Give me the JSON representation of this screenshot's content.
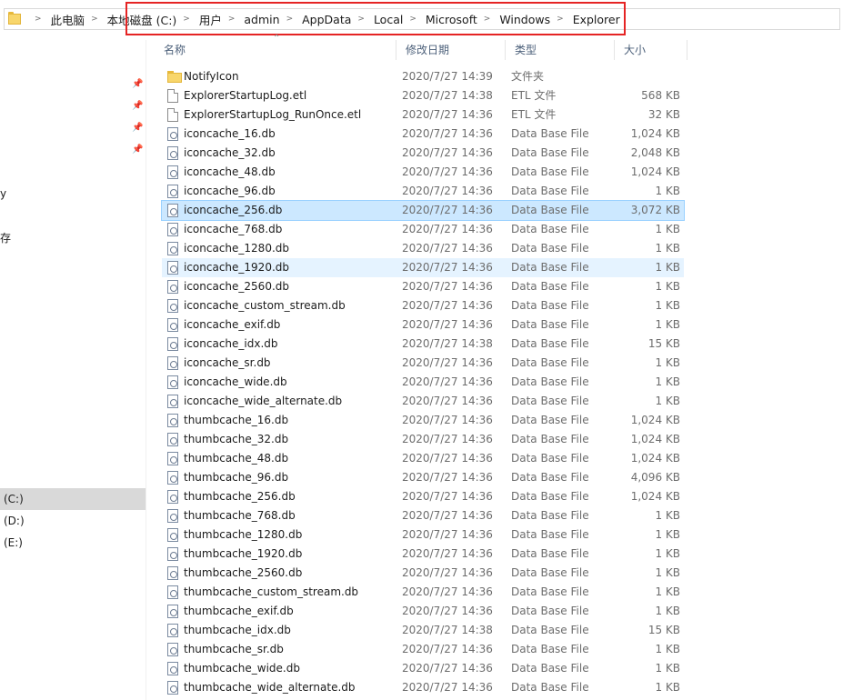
{
  "address": {
    "crumbs": [
      "此电脑",
      "本地磁盘 (C:)",
      "用户",
      "admin",
      "AppData",
      "Local",
      "Microsoft",
      "Windows",
      "Explorer"
    ]
  },
  "nav": {
    "fragment1": "y",
    "fragment2": "存",
    "drives": [
      "(C:)",
      "(D:)",
      "(E:)"
    ]
  },
  "columns": {
    "name": "名称",
    "date": "修改日期",
    "type": "类型",
    "size": "大小"
  },
  "files": [
    {
      "name": "NotifyIcon",
      "date": "2020/7/27 14:39",
      "type": "文件夹",
      "size": "",
      "icon": "folder-icon"
    },
    {
      "name": "ExplorerStartupLog.etl",
      "date": "2020/7/27 14:38",
      "type": "ETL 文件",
      "size": "568 KB",
      "icon": "file-icon"
    },
    {
      "name": "ExplorerStartupLog_RunOnce.etl",
      "date": "2020/7/27 14:36",
      "type": "ETL 文件",
      "size": "32 KB",
      "icon": "file-icon"
    },
    {
      "name": "iconcache_16.db",
      "date": "2020/7/27 14:36",
      "type": "Data Base File",
      "size": "1,024 KB",
      "icon": "database-file-icon"
    },
    {
      "name": "iconcache_32.db",
      "date": "2020/7/27 14:36",
      "type": "Data Base File",
      "size": "2,048 KB",
      "icon": "database-file-icon"
    },
    {
      "name": "iconcache_48.db",
      "date": "2020/7/27 14:36",
      "type": "Data Base File",
      "size": "1,024 KB",
      "icon": "database-file-icon"
    },
    {
      "name": "iconcache_96.db",
      "date": "2020/7/27 14:36",
      "type": "Data Base File",
      "size": "1 KB",
      "icon": "database-file-icon"
    },
    {
      "name": "iconcache_256.db",
      "date": "2020/7/27 14:36",
      "type": "Data Base File",
      "size": "3,072 KB",
      "icon": "database-file-icon",
      "state": "selected"
    },
    {
      "name": "iconcache_768.db",
      "date": "2020/7/27 14:36",
      "type": "Data Base File",
      "size": "1 KB",
      "icon": "database-file-icon"
    },
    {
      "name": "iconcache_1280.db",
      "date": "2020/7/27 14:36",
      "type": "Data Base File",
      "size": "1 KB",
      "icon": "database-file-icon"
    },
    {
      "name": "iconcache_1920.db",
      "date": "2020/7/27 14:36",
      "type": "Data Base File",
      "size": "1 KB",
      "icon": "database-file-icon",
      "state": "hover"
    },
    {
      "name": "iconcache_2560.db",
      "date": "2020/7/27 14:36",
      "type": "Data Base File",
      "size": "1 KB",
      "icon": "database-file-icon"
    },
    {
      "name": "iconcache_custom_stream.db",
      "date": "2020/7/27 14:36",
      "type": "Data Base File",
      "size": "1 KB",
      "icon": "database-file-icon"
    },
    {
      "name": "iconcache_exif.db",
      "date": "2020/7/27 14:36",
      "type": "Data Base File",
      "size": "1 KB",
      "icon": "database-file-icon"
    },
    {
      "name": "iconcache_idx.db",
      "date": "2020/7/27 14:38",
      "type": "Data Base File",
      "size": "15 KB",
      "icon": "database-file-icon"
    },
    {
      "name": "iconcache_sr.db",
      "date": "2020/7/27 14:36",
      "type": "Data Base File",
      "size": "1 KB",
      "icon": "database-file-icon"
    },
    {
      "name": "iconcache_wide.db",
      "date": "2020/7/27 14:36",
      "type": "Data Base File",
      "size": "1 KB",
      "icon": "database-file-icon"
    },
    {
      "name": "iconcache_wide_alternate.db",
      "date": "2020/7/27 14:36",
      "type": "Data Base File",
      "size": "1 KB",
      "icon": "database-file-icon"
    },
    {
      "name": "thumbcache_16.db",
      "date": "2020/7/27 14:36",
      "type": "Data Base File",
      "size": "1,024 KB",
      "icon": "database-file-icon"
    },
    {
      "name": "thumbcache_32.db",
      "date": "2020/7/27 14:36",
      "type": "Data Base File",
      "size": "1,024 KB",
      "icon": "database-file-icon"
    },
    {
      "name": "thumbcache_48.db",
      "date": "2020/7/27 14:36",
      "type": "Data Base File",
      "size": "1,024 KB",
      "icon": "database-file-icon"
    },
    {
      "name": "thumbcache_96.db",
      "date": "2020/7/27 14:36",
      "type": "Data Base File",
      "size": "4,096 KB",
      "icon": "database-file-icon"
    },
    {
      "name": "thumbcache_256.db",
      "date": "2020/7/27 14:36",
      "type": "Data Base File",
      "size": "1,024 KB",
      "icon": "database-file-icon"
    },
    {
      "name": "thumbcache_768.db",
      "date": "2020/7/27 14:36",
      "type": "Data Base File",
      "size": "1 KB",
      "icon": "database-file-icon"
    },
    {
      "name": "thumbcache_1280.db",
      "date": "2020/7/27 14:36",
      "type": "Data Base File",
      "size": "1 KB",
      "icon": "database-file-icon"
    },
    {
      "name": "thumbcache_1920.db",
      "date": "2020/7/27 14:36",
      "type": "Data Base File",
      "size": "1 KB",
      "icon": "database-file-icon"
    },
    {
      "name": "thumbcache_2560.db",
      "date": "2020/7/27 14:36",
      "type": "Data Base File",
      "size": "1 KB",
      "icon": "database-file-icon"
    },
    {
      "name": "thumbcache_custom_stream.db",
      "date": "2020/7/27 14:36",
      "type": "Data Base File",
      "size": "1 KB",
      "icon": "database-file-icon"
    },
    {
      "name": "thumbcache_exif.db",
      "date": "2020/7/27 14:36",
      "type": "Data Base File",
      "size": "1 KB",
      "icon": "database-file-icon"
    },
    {
      "name": "thumbcache_idx.db",
      "date": "2020/7/27 14:38",
      "type": "Data Base File",
      "size": "15 KB",
      "icon": "database-file-icon"
    },
    {
      "name": "thumbcache_sr.db",
      "date": "2020/7/27 14:36",
      "type": "Data Base File",
      "size": "1 KB",
      "icon": "database-file-icon"
    },
    {
      "name": "thumbcache_wide.db",
      "date": "2020/7/27 14:36",
      "type": "Data Base File",
      "size": "1 KB",
      "icon": "database-file-icon"
    },
    {
      "name": "thumbcache_wide_alternate.db",
      "date": "2020/7/27 14:36",
      "type": "Data Base File",
      "size": "1 KB",
      "icon": "database-file-icon"
    }
  ],
  "colors": {
    "selected_row": "#cce8ff",
    "hover_row": "#e5f3ff",
    "highlight_border": "#e52424",
    "header_text": "#4c607a"
  }
}
